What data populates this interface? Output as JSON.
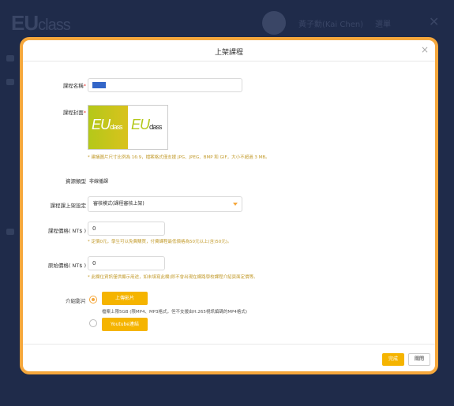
{
  "background": {
    "logo_main": "EU",
    "logo_sub": "class",
    "user_name": "黃子勳(Kai Chen)",
    "menu_label": "選單",
    "close_glyph": "✕"
  },
  "modal": {
    "title": "上架課程",
    "close_glyph": "×"
  },
  "form": {
    "course_name": {
      "label": "課程名稱",
      "required": "*",
      "value": "test"
    },
    "course_cover": {
      "label": "課程封面",
      "required": "*",
      "cover_left_text": "EU",
      "cover_left_sub": "class",
      "cover_right_text": "EU",
      "cover_right_sub": "class",
      "hint": "* 建議圖片尺寸比例為 16:9，檔案格式僅支援 JPG、JPEG、BMP 和 GIF，大小不超過 3 MB。"
    },
    "resource_type": {
      "label": "資源類型",
      "value": "非線播課"
    },
    "publish_setting": {
      "label": "課程課上架設定",
      "value": "審核模式(課程審核上架)"
    },
    "course_price": {
      "label": "課程價格( NT$ )",
      "value": "0",
      "hint": "* 定價0元，學生可以免費購買，付費課程最低價格為50元以上(含)50元)。"
    },
    "original_price": {
      "label": "原始價格( NT$ )",
      "value": "0",
      "hint": "* 此欄位資訊僅供顯示用途，如未填寫此欄(即不會出現在網路學校課程介紹頁面定價等。"
    },
    "intro_video": {
      "label": "介紹影片",
      "upload_button": "上傳影片",
      "upload_hint": "檔案上限5GB (限MP4、MP3格式，但不支援由H.265視訊編碼的MP4格式)",
      "youtube_button": "Youtube連結"
    }
  },
  "footer": {
    "confirm_label": "完成",
    "close_label": "關閉"
  },
  "colors": {
    "accent": "#f5a73c",
    "button": "#f5b400",
    "hint_text": "#c29b2c",
    "overlay": "#1f2b4a"
  }
}
